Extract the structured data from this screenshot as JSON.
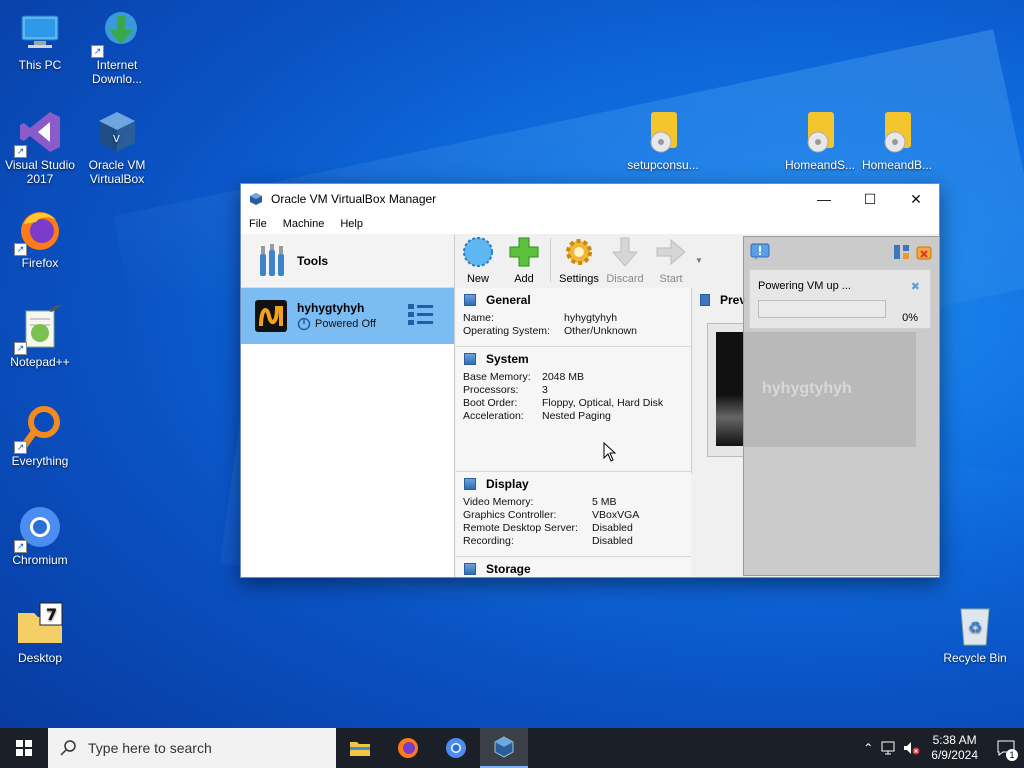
{
  "desktop": {
    "icons": [
      {
        "label_line1": "This PC",
        "label_line2": ""
      },
      {
        "label_line1": "Internet",
        "label_line2": "Downlo..."
      },
      {
        "label_line1": "Visual Studio",
        "label_line2": "2017"
      },
      {
        "label_line1": "Oracle VM",
        "label_line2": "VirtualBox"
      },
      {
        "label_line1": "Firefox",
        "label_line2": ""
      },
      {
        "label_line1": "Notepad++",
        "label_line2": ""
      },
      {
        "label_line1": "Everything",
        "label_line2": ""
      },
      {
        "label_line1": "Chromium",
        "label_line2": ""
      },
      {
        "label_line1": "Desktop",
        "label_line2": ""
      },
      {
        "label_line1": "setupconsu...",
        "label_line2": ""
      },
      {
        "label_line1": "HomeandS...",
        "label_line2": ""
      },
      {
        "label_line1": "HomeandB...",
        "label_line2": ""
      },
      {
        "label_line1": "Recycle Bin",
        "label_line2": ""
      }
    ]
  },
  "window": {
    "title": "Oracle VM VirtualBox Manager",
    "menu": [
      "File",
      "Machine",
      "Help"
    ],
    "tools_label": "Tools",
    "vm": {
      "name": "hyhygtyhyh",
      "state": "Powered Off"
    },
    "toolbar": [
      {
        "label": "New",
        "enabled": true
      },
      {
        "label": "Add",
        "enabled": true
      },
      {
        "label": "Settings",
        "enabled": true
      },
      {
        "label": "Discard",
        "enabled": false
      },
      {
        "label": "Start",
        "enabled": false
      }
    ],
    "details": {
      "general": {
        "title": "General",
        "rows": [
          {
            "k": "Name:",
            "v": "hyhygtyhyh"
          },
          {
            "k": "Operating System:",
            "v": "Other/Unknown"
          }
        ]
      },
      "system": {
        "title": "System",
        "rows": [
          {
            "k": "Base Memory:",
            "v": "2048 MB"
          },
          {
            "k": "Processors:",
            "v": "3"
          },
          {
            "k": "Boot Order:",
            "v": "Floppy, Optical, Hard Disk"
          },
          {
            "k": "Acceleration:",
            "v": "Nested Paging"
          }
        ]
      },
      "display": {
        "title": "Display",
        "rows": [
          {
            "k": "Video Memory:",
            "v": "5 MB"
          },
          {
            "k": "Graphics Controller:",
            "v": "VBoxVGA"
          },
          {
            "k": "Remote Desktop Server:",
            "v": "Disabled"
          },
          {
            "k": "Recording:",
            "v": "Disabled"
          }
        ]
      },
      "storage": {
        "title": "Storage"
      },
      "preview_title": "Prev"
    },
    "progress": {
      "text": "Powering VM up ...",
      "percent_label": "0%",
      "percent_value": 0,
      "preview_vm_name": "hyhygtyhyh"
    }
  },
  "taskbar": {
    "search_placeholder": "Type here to search",
    "time": "5:38 AM",
    "date": "6/9/2024",
    "notification_count": "1"
  }
}
